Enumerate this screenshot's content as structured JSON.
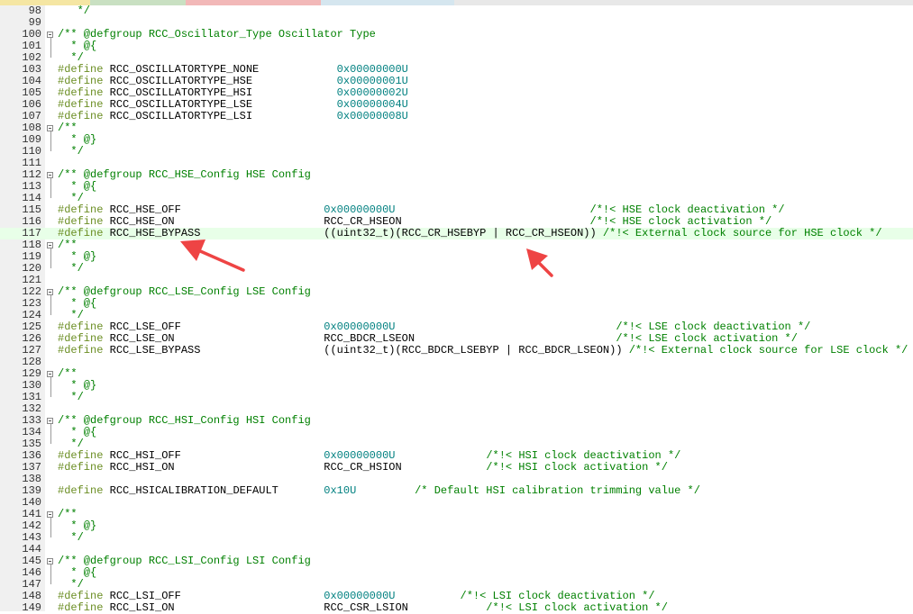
{
  "editor": {
    "colors": {
      "comment": "#008000",
      "preprocessor": "#6b8e23",
      "number": "#008080",
      "highlight_line": "#e8ffe8",
      "annotation_arrow": "#ee4444"
    },
    "tabs": [
      {
        "color": "#f5e6a3"
      },
      {
        "color": "#c9e0c2"
      },
      {
        "color": "#f2b8b8"
      },
      {
        "color": "#d5e6ef"
      },
      {
        "color": "#e8e8e8"
      }
    ],
    "lines": [
      {
        "n": "98",
        "tokens": [
          {
            "t": "   */",
            "c": "cm"
          }
        ]
      },
      {
        "n": "99",
        "tokens": []
      },
      {
        "n": "100",
        "tokens": [
          {
            "t": "/** @defgroup RCC_Oscillator_Type Oscillator Type",
            "c": "cm"
          }
        ]
      },
      {
        "n": "101",
        "tokens": [
          {
            "t": "  * @{",
            "c": "cm"
          }
        ]
      },
      {
        "n": "102",
        "tokens": [
          {
            "t": "  */",
            "c": "cm"
          }
        ]
      },
      {
        "n": "103",
        "tokens": [
          {
            "t": "#define",
            "c": "pp"
          },
          {
            "t": " RCC_OSCILLATORTYPE_NONE            ",
            "c": ""
          },
          {
            "t": "0x00000000U",
            "c": "nm"
          }
        ]
      },
      {
        "n": "104",
        "tokens": [
          {
            "t": "#define",
            "c": "pp"
          },
          {
            "t": " RCC_OSCILLATORTYPE_HSE             ",
            "c": ""
          },
          {
            "t": "0x00000001U",
            "c": "nm"
          }
        ]
      },
      {
        "n": "105",
        "tokens": [
          {
            "t": "#define",
            "c": "pp"
          },
          {
            "t": " RCC_OSCILLATORTYPE_HSI             ",
            "c": ""
          },
          {
            "t": "0x00000002U",
            "c": "nm"
          }
        ]
      },
      {
        "n": "106",
        "tokens": [
          {
            "t": "#define",
            "c": "pp"
          },
          {
            "t": " RCC_OSCILLATORTYPE_LSE             ",
            "c": ""
          },
          {
            "t": "0x00000004U",
            "c": "nm"
          }
        ]
      },
      {
        "n": "107",
        "tokens": [
          {
            "t": "#define",
            "c": "pp"
          },
          {
            "t": " RCC_OSCILLATORTYPE_LSI             ",
            "c": ""
          },
          {
            "t": "0x00000008U",
            "c": "nm"
          }
        ]
      },
      {
        "n": "108",
        "tokens": [
          {
            "t": "/**",
            "c": "cm"
          }
        ]
      },
      {
        "n": "109",
        "tokens": [
          {
            "t": "  * @}",
            "c": "cm"
          }
        ]
      },
      {
        "n": "110",
        "tokens": [
          {
            "t": "  */",
            "c": "cm"
          }
        ]
      },
      {
        "n": "111",
        "tokens": []
      },
      {
        "n": "112",
        "tokens": [
          {
            "t": "/** @defgroup RCC_HSE_Config HSE Config",
            "c": "cm"
          }
        ]
      },
      {
        "n": "113",
        "tokens": [
          {
            "t": "  * @{",
            "c": "cm"
          }
        ]
      },
      {
        "n": "114",
        "tokens": [
          {
            "t": "  */",
            "c": "cm"
          }
        ]
      },
      {
        "n": "115",
        "tokens": [
          {
            "t": "#define",
            "c": "pp"
          },
          {
            "t": " RCC_HSE_OFF                      ",
            "c": ""
          },
          {
            "t": "0x00000000U",
            "c": "nm"
          },
          {
            "t": "                              ",
            "c": ""
          },
          {
            "t": "/*!< HSE clock deactivation */",
            "c": "cm"
          }
        ]
      },
      {
        "n": "116",
        "tokens": [
          {
            "t": "#define",
            "c": "pp"
          },
          {
            "t": " RCC_HSE_ON                       RCC_CR_HSEON                             ",
            "c": ""
          },
          {
            "t": "/*!< HSE clock activation */",
            "c": "cm"
          }
        ]
      },
      {
        "n": "117",
        "hl": true,
        "tokens": [
          {
            "t": "#define",
            "c": "pp"
          },
          {
            "t": " RCC_HSE_BYPASS                   ((uint32_t)(RCC_CR_HSEBYP | RCC_CR_HSEON)) ",
            "c": ""
          },
          {
            "t": "/*!< External clock source for HSE clock */",
            "c": "cm"
          }
        ]
      },
      {
        "n": "118",
        "tokens": [
          {
            "t": "/**",
            "c": "cm"
          }
        ]
      },
      {
        "n": "119",
        "tokens": [
          {
            "t": "  * @}",
            "c": "cm"
          }
        ]
      },
      {
        "n": "120",
        "tokens": [
          {
            "t": "  */",
            "c": "cm"
          }
        ]
      },
      {
        "n": "121",
        "tokens": []
      },
      {
        "n": "122",
        "tokens": [
          {
            "t": "/** @defgroup RCC_LSE_Config LSE Config",
            "c": "cm"
          }
        ]
      },
      {
        "n": "123",
        "tokens": [
          {
            "t": "  * @{",
            "c": "cm"
          }
        ]
      },
      {
        "n": "124",
        "tokens": [
          {
            "t": "  */",
            "c": "cm"
          }
        ]
      },
      {
        "n": "125",
        "tokens": [
          {
            "t": "#define",
            "c": "pp"
          },
          {
            "t": " RCC_LSE_OFF                      ",
            "c": ""
          },
          {
            "t": "0x00000000U",
            "c": "nm"
          },
          {
            "t": "                                  ",
            "c": ""
          },
          {
            "t": "/*!< LSE clock deactivation */",
            "c": "cm"
          }
        ]
      },
      {
        "n": "126",
        "tokens": [
          {
            "t": "#define",
            "c": "pp"
          },
          {
            "t": " RCC_LSE_ON                       RCC_BDCR_LSEON                               ",
            "c": ""
          },
          {
            "t": "/*!< LSE clock activation */",
            "c": "cm"
          }
        ]
      },
      {
        "n": "127",
        "tokens": [
          {
            "t": "#define",
            "c": "pp"
          },
          {
            "t": " RCC_LSE_BYPASS                   ((uint32_t)(RCC_BDCR_LSEBYP | RCC_BDCR_LSEON)) ",
            "c": ""
          },
          {
            "t": "/*!< External clock source for LSE clock */",
            "c": "cm"
          }
        ]
      },
      {
        "n": "128",
        "tokens": []
      },
      {
        "n": "129",
        "tokens": [
          {
            "t": "/**",
            "c": "cm"
          }
        ]
      },
      {
        "n": "130",
        "tokens": [
          {
            "t": "  * @}",
            "c": "cm"
          }
        ]
      },
      {
        "n": "131",
        "tokens": [
          {
            "t": "  */",
            "c": "cm"
          }
        ]
      },
      {
        "n": "132",
        "tokens": []
      },
      {
        "n": "133",
        "tokens": [
          {
            "t": "/** @defgroup RCC_HSI_Config HSI Config",
            "c": "cm"
          }
        ]
      },
      {
        "n": "134",
        "tokens": [
          {
            "t": "  * @{",
            "c": "cm"
          }
        ]
      },
      {
        "n": "135",
        "tokens": [
          {
            "t": "  */",
            "c": "cm"
          }
        ]
      },
      {
        "n": "136",
        "tokens": [
          {
            "t": "#define",
            "c": "pp"
          },
          {
            "t": " RCC_HSI_OFF                      ",
            "c": ""
          },
          {
            "t": "0x00000000U",
            "c": "nm"
          },
          {
            "t": "              ",
            "c": ""
          },
          {
            "t": "/*!< HSI clock deactivation */",
            "c": "cm"
          }
        ]
      },
      {
        "n": "137",
        "tokens": [
          {
            "t": "#define",
            "c": "pp"
          },
          {
            "t": " RCC_HSI_ON                       RCC_CR_HSION             ",
            "c": ""
          },
          {
            "t": "/*!< HSI clock activation */",
            "c": "cm"
          }
        ]
      },
      {
        "n": "138",
        "tokens": []
      },
      {
        "n": "139",
        "tokens": [
          {
            "t": "#define",
            "c": "pp"
          },
          {
            "t": " RCC_HSICALIBRATION_DEFAULT       ",
            "c": ""
          },
          {
            "t": "0x10U",
            "c": "nm"
          },
          {
            "t": "         ",
            "c": ""
          },
          {
            "t": "/* Default HSI calibration trimming value */",
            "c": "cm"
          }
        ]
      },
      {
        "n": "140",
        "tokens": []
      },
      {
        "n": "141",
        "tokens": [
          {
            "t": "/**",
            "c": "cm"
          }
        ]
      },
      {
        "n": "142",
        "tokens": [
          {
            "t": "  * @}",
            "c": "cm"
          }
        ]
      },
      {
        "n": "143",
        "tokens": [
          {
            "t": "  */",
            "c": "cm"
          }
        ]
      },
      {
        "n": "144",
        "tokens": []
      },
      {
        "n": "145",
        "tokens": [
          {
            "t": "/** @defgroup RCC_LSI_Config LSI Config",
            "c": "cm"
          }
        ]
      },
      {
        "n": "146",
        "tokens": [
          {
            "t": "  * @{",
            "c": "cm"
          }
        ]
      },
      {
        "n": "147",
        "tokens": [
          {
            "t": "  */",
            "c": "cm"
          }
        ]
      },
      {
        "n": "148",
        "tokens": [
          {
            "t": "#define",
            "c": "pp"
          },
          {
            "t": " RCC_LSI_OFF                      ",
            "c": ""
          },
          {
            "t": "0x00000000U",
            "c": "nm"
          },
          {
            "t": "          ",
            "c": ""
          },
          {
            "t": "/*!< LSI clock deactivation */",
            "c": "cm"
          }
        ]
      },
      {
        "n": "149",
        "tokens": [
          {
            "t": "#define",
            "c": "pp"
          },
          {
            "t": " RCC_LSI_ON                       RCC_CSR_LSION            ",
            "c": ""
          },
          {
            "t": "/*!< LSI clock activation */",
            "c": "cm"
          }
        ]
      }
    ]
  }
}
